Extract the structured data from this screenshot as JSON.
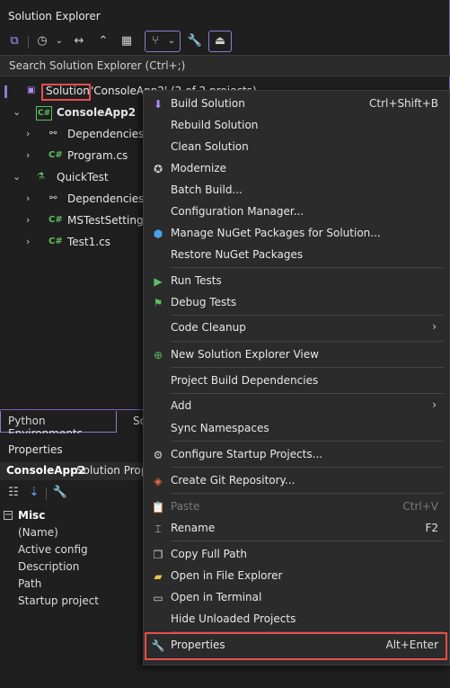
{
  "solution_explorer": {
    "title": "Solution Explorer",
    "search_placeholder": "Search Solution Explorer (Ctrl+;)",
    "toolbar_icons": [
      "vs-switch-views-icon",
      "history-icon",
      "chevron-down-icon",
      "sync-icon",
      "collapse-all-icon",
      "show-all-files-icon",
      "git-filter-icon",
      "chevron-down-icon",
      "wrench-icon",
      "preview-icon"
    ],
    "tree": [
      {
        "label": "Solution",
        "suffix": "'ConsoleApp2' (2 of 2 projects)",
        "icon": "solution-icon"
      },
      {
        "label": "ConsoleApp2",
        "icon": "csharp-project-icon",
        "bold": true
      },
      {
        "label": "Dependencies",
        "icon": "dependencies-icon"
      },
      {
        "label": "Program.cs",
        "icon": "csharp-file-icon"
      },
      {
        "label": "QuickTest",
        "icon": "test-project-icon"
      },
      {
        "label": "Dependencies",
        "icon": "dependencies-icon"
      },
      {
        "label": "MSTestSettings.cs",
        "icon": "csharp-file-icon"
      },
      {
        "label": "Test1.cs",
        "icon": "csharp-file-icon"
      }
    ]
  },
  "tabs": {
    "python_env": "Python Environments",
    "solution_short": "So"
  },
  "properties": {
    "title": "Properties",
    "object_name": "ConsoleApp2",
    "object_type": "Solution Properties",
    "category": "Misc",
    "rows": [
      "(Name)",
      "Active config",
      "Description",
      "Path",
      "Startup project"
    ]
  },
  "context_menu": {
    "items": [
      {
        "label": "Build Solution",
        "shortcut": "Ctrl+Shift+B",
        "icon": "build-icon"
      },
      {
        "label": "Rebuild Solution",
        "shortcut": "",
        "icon": ""
      },
      {
        "label": "Clean Solution",
        "shortcut": "",
        "icon": ""
      },
      {
        "label": "Modernize",
        "shortcut": "",
        "icon": "copilot-icon"
      },
      {
        "label": "Batch Build...",
        "shortcut": "",
        "icon": ""
      },
      {
        "label": "Configuration Manager...",
        "shortcut": "",
        "icon": ""
      },
      {
        "label": "Manage NuGet Packages for Solution...",
        "shortcut": "",
        "icon": "nuget-icon"
      },
      {
        "label": "Restore NuGet Packages",
        "shortcut": "",
        "icon": ""
      },
      {
        "label": "Run Tests",
        "shortcut": "",
        "icon": "run-tests-icon"
      },
      {
        "label": "Debug Tests",
        "shortcut": "",
        "icon": "debug-tests-icon"
      },
      {
        "label": "Code Cleanup",
        "shortcut": "",
        "icon": "",
        "submenu": true
      },
      {
        "label": "New Solution Explorer View",
        "shortcut": "",
        "icon": "new-view-icon"
      },
      {
        "label": "Project Build Dependencies",
        "shortcut": "",
        "icon": ""
      },
      {
        "label": "Add",
        "shortcut": "",
        "icon": "",
        "submenu": true
      },
      {
        "label": "Sync Namespaces",
        "shortcut": "",
        "icon": ""
      },
      {
        "label": "Configure Startup Projects...",
        "shortcut": "",
        "icon": "gear-icon"
      },
      {
        "label": "Create Git Repository...",
        "shortcut": "",
        "icon": "git-add-icon"
      },
      {
        "label": "Paste",
        "shortcut": "Ctrl+V",
        "icon": "paste-icon",
        "disabled": true
      },
      {
        "label": "Rename",
        "shortcut": "F2",
        "icon": "rename-icon"
      },
      {
        "label": "Copy Full Path",
        "shortcut": "",
        "icon": "copy-icon"
      },
      {
        "label": "Open in File Explorer",
        "shortcut": "",
        "icon": "folder-open-icon"
      },
      {
        "label": "Open in Terminal",
        "shortcut": "",
        "icon": "terminal-icon"
      },
      {
        "label": "Hide Unloaded Projects",
        "shortcut": "",
        "icon": ""
      },
      {
        "label": "Properties",
        "shortcut": "Alt+Enter",
        "icon": "wrench-icon"
      }
    ]
  },
  "colors": {
    "accent": "#8d7bd0",
    "highlight": "#e84d4d",
    "csharp": "#5fbf5f"
  }
}
